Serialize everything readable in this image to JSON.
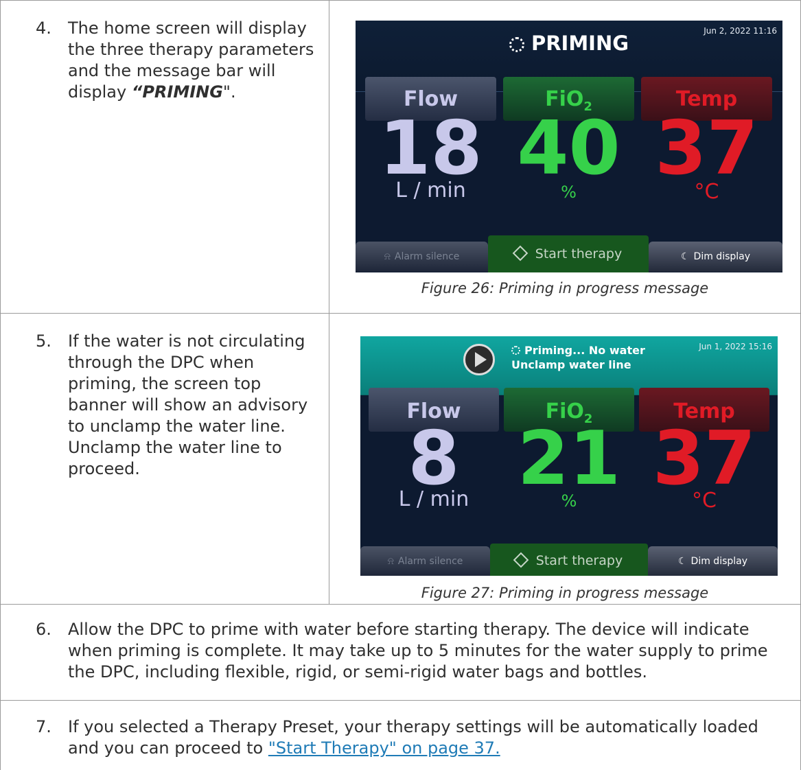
{
  "rows": {
    "step4": {
      "number": "4.",
      "text_before": "The home screen will display the three therapy parameters and the message bar will display ",
      "text_emphasis": "“PRIMING",
      "text_after": "\"."
    },
    "step5": {
      "number": "5.",
      "text": "If the water is not circulating through the DPC when priming, the screen top banner will show an advisory to unclamp the water line. Unclamp the water line to proceed."
    },
    "step6": {
      "number": "6.",
      "text": "Allow the DPC to prime with water before starting therapy. The device will indicate when priming is complete. It may take up to 5 minutes for the water supply to prime the DPC, including flexible, rigid, or semi-rigid water bags and bottles."
    },
    "step7": {
      "number": "7.",
      "text_before": "If you selected a Therapy Preset, your therapy settings will be automatically loaded and you can proceed to ",
      "link": "\"Start Therapy\" on page 37."
    }
  },
  "figure26": {
    "caption": "Figure 26: Priming in progress message",
    "header_title": "PRIMING",
    "date": "Jun 2, 2022 11:16",
    "flow_label": "Flow",
    "flow_value": "18",
    "flow_unit": "L / min",
    "fio2_label": "FiO",
    "fio2_sub": "2",
    "fio2_value": "40",
    "fio2_unit": "%",
    "temp_label": "Temp",
    "temp_value": "37",
    "temp_unit": "°C",
    "alarm_silence": "Alarm silence",
    "start_therapy": "Start therapy",
    "dim_display": "Dim display"
  },
  "figure27": {
    "caption": "Figure 27: Priming in progress message",
    "message_line1": "Priming... No water",
    "message_line2": "Unclamp water line",
    "date": "Jun 1, 2022 15:16",
    "flow_label": "Flow",
    "flow_value": "8",
    "flow_unit": "L / min",
    "fio2_label": "FiO",
    "fio2_sub": "2",
    "fio2_value": "21",
    "fio2_unit": "%",
    "temp_label": "Temp",
    "temp_value": "37",
    "temp_unit": "°C",
    "alarm_silence": "Alarm silence",
    "start_therapy": "Start therapy",
    "dim_display": "Dim display"
  },
  "icons": [
    "spinner-icon",
    "play-icon",
    "alarm-silence-icon",
    "start-diamond-icon",
    "moon-icon"
  ],
  "colors": {
    "flow": "#c8c8ea",
    "fio2": "#36d14a",
    "temp": "#e01b26",
    "link": "#1f7bb6",
    "banner_teal": "#10a6a0"
  }
}
